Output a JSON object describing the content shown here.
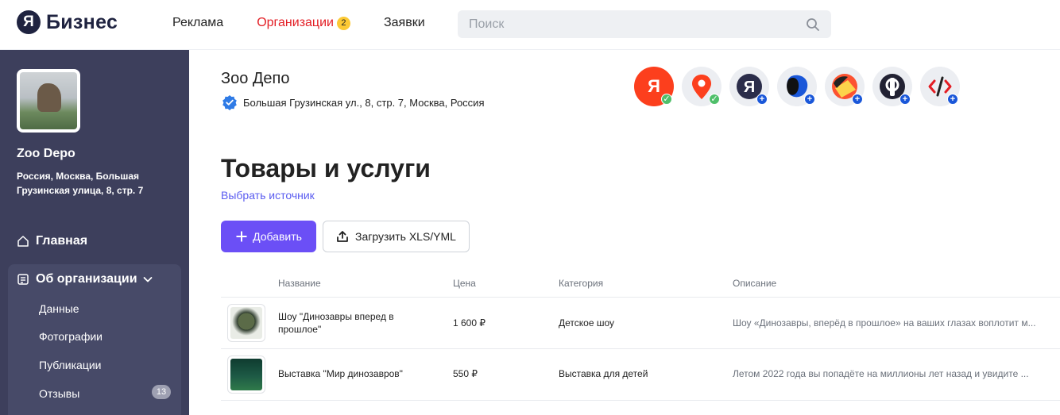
{
  "header": {
    "logo_letter": "Я",
    "logo_text": "Бизнес",
    "nav": [
      {
        "label": "Реклама"
      },
      {
        "label": "Организации",
        "badge": "2"
      },
      {
        "label": "Заявки"
      }
    ],
    "search_placeholder": "Поиск"
  },
  "sidebar": {
    "org_name": "Zoo Depo",
    "org_address": "Россия, Москва, Большая Грузинская улица, 8, стр. 7",
    "main_label": "Главная",
    "group_label": "Об организации",
    "items": [
      {
        "label": "Данные"
      },
      {
        "label": "Фотографии"
      },
      {
        "label": "Публикации"
      },
      {
        "label": "Отзывы",
        "count": "13"
      }
    ]
  },
  "org": {
    "title": "Зоо Депо",
    "address": "Большая Грузинская ул., 8, стр. 7, Москва, Россия"
  },
  "services": [
    {
      "icon": "yandex-red-icon",
      "status": "ok",
      "color": "#fc3f1d"
    },
    {
      "icon": "maps-pin-icon",
      "status": "ok",
      "color": "#fc3f1d"
    },
    {
      "icon": "yandex-dark-icon",
      "status": "add",
      "color": "#2b2d4a"
    },
    {
      "icon": "navigator-blob-icon",
      "status": "add",
      "color": "#1a57d9"
    },
    {
      "icon": "eda-icon",
      "status": "add",
      "color": "#fc5230"
    },
    {
      "icon": "f-logo-icon",
      "status": "add",
      "color": "#222233"
    },
    {
      "icon": "code-tools-icon",
      "status": "add",
      "color": "#e31d24"
    }
  ],
  "main": {
    "heading": "Товары и услуги",
    "choose_source": "Выбрать источник",
    "add_label": "Добавить",
    "upload_label": "Загрузить XLS/YML"
  },
  "table": {
    "headers": [
      "Название",
      "Цена",
      "Категория",
      "Описание"
    ],
    "rows": [
      {
        "name": "Шоу \"Динозавры вперед в прошлое\"",
        "price": "1 600 ₽",
        "category": "Детское шоу",
        "description": "Шоу «Динозавры, вперёд в прошлое» на ваших глазах воплотит м..."
      },
      {
        "name": "Выставка \"Мир динозавров\"",
        "price": "550 ₽",
        "category": "Выставка для детей",
        "description": "Летом 2022 года вы попадёте на миллионы лет назад и увидите ..."
      }
    ]
  },
  "colors": {
    "accent": "#6b4ff6",
    "sidebar": "#3d3f5c",
    "link": "#5a5cf0",
    "active_nav": "#e31d24"
  }
}
